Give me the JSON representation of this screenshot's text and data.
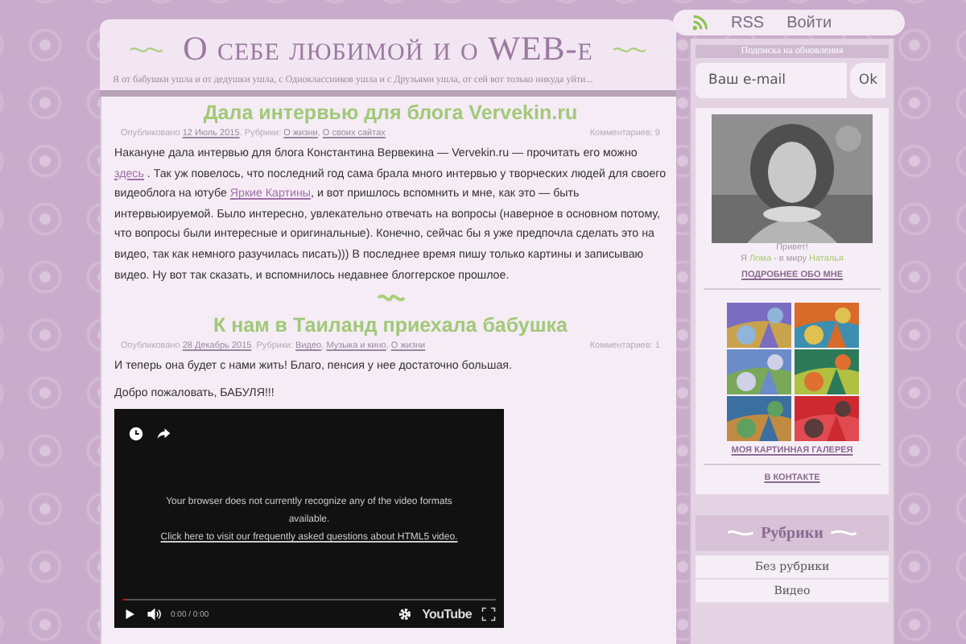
{
  "header": {
    "title": "О себе любимой и о WEB-е",
    "tagline": "Я от бабушки ушла и от дедушки ушла, с Одноклассников ушла и с Друзьями ушла, от сей вот только никуда уйти..."
  },
  "topbar": {
    "rss": "RSS",
    "login": "Войти"
  },
  "posts": [
    {
      "title": "Дала интервью для блога Vervekin.ru",
      "meta": {
        "parts": [
          {
            "kind": "plain",
            "text": "Опубликовано "
          },
          {
            "kind": "link",
            "text": "12 Июль 2015"
          },
          {
            "kind": "plain",
            "text": ". Рубрики: "
          },
          {
            "kind": "link",
            "text": "О жизни"
          },
          {
            "kind": "plain",
            "text": ", "
          },
          {
            "kind": "link",
            "text": "О своих сайтах"
          }
        ],
        "comments": "Комментариев: 9"
      },
      "paragraphs": [
        [
          {
            "kind": "plain",
            "text": "Накануне дала интервью для блога Константина Вервекина — Vervekin.ru — прочитать его можно "
          },
          {
            "kind": "link",
            "text": "здесь"
          },
          {
            "kind": "plain",
            "text": " . Так уж повелось, что последний год сама брала много интервью у творческих людей для своего видеоблога на ютубе "
          },
          {
            "kind": "link",
            "text": "Яркие Картины"
          },
          {
            "kind": "plain",
            "text": ", и вот пришлось вспомнить и мне, как это — быть интервьюируемой. Было интересно, увлекательно отвечать на вопросы (наверное в основном потому, что вопросы были интересные и оригинальные). Конечно, сейчас бы я уже предпочла сделать это на видео, так как немного разучилась писать))) В последнее время пишу только картины и записываю видео. Ну вот так сказать, и вспомнилось недавнее блоггерское прошлое."
          }
        ]
      ]
    },
    {
      "title": "К нам в Таиланд приехала бабушка",
      "meta": {
        "parts": [
          {
            "kind": "plain",
            "text": "Опубликовано "
          },
          {
            "kind": "link",
            "text": "28 Декабрь 2015"
          },
          {
            "kind": "plain",
            "text": ". Рубрики: "
          },
          {
            "kind": "link",
            "text": "Видео"
          },
          {
            "kind": "plain",
            "text": ", "
          },
          {
            "kind": "link",
            "text": "Музыка и кино"
          },
          {
            "kind": "plain",
            "text": ", "
          },
          {
            "kind": "link",
            "text": "О жизни"
          }
        ],
        "comments": "Комментариев: 1"
      },
      "paragraphs": [
        [
          {
            "kind": "plain",
            "text": "И теперь она будет с нами жить! Благо, пенсия у нее достаточно большая."
          }
        ],
        [
          {
            "kind": "plain",
            "text": "Добро пожаловать, БАБУЛЯ!!!"
          }
        ]
      ],
      "video": {
        "level": 0,
        "message": "Your browser does not currently recognize any of the video formats available.",
        "link": "Click here to visit our frequently asked questions about HTML5 video.",
        "time": "0:00 / 0:00",
        "brand": "YouTube"
      }
    }
  ],
  "subscribe": {
    "title": "Подписка на обновления",
    "placeholder": "Ваш e-mail",
    "button": "Ok"
  },
  "profile": {
    "greeting": "Привет!",
    "intro": [
      {
        "kind": "plain",
        "text": "Я "
      },
      {
        "kind": "name",
        "text": "Лома"
      },
      {
        "kind": "plain",
        "text": " - в миру "
      },
      {
        "kind": "name",
        "text": "Наталья"
      }
    ],
    "link": "ПОДРОБНЕЕ ОБО МНЕ"
  },
  "gallery": {
    "link": "МОЯ КАРТИННАЯ ГАЛЕРЕЯ"
  },
  "vk": {
    "link": "В КОНТАКТЕ"
  },
  "categories": {
    "title": "Рубрики",
    "items": [
      "Без рубрики",
      "Видео"
    ]
  }
}
